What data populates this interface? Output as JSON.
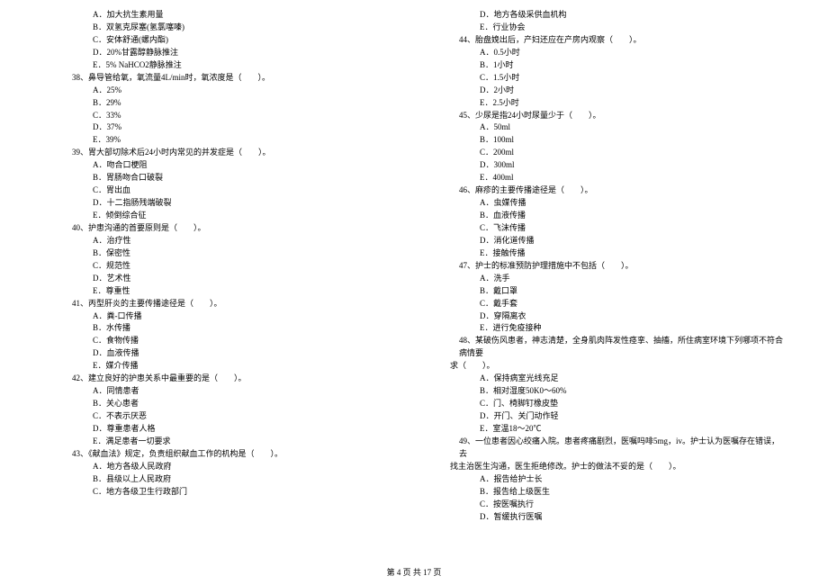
{
  "left_column": {
    "pre_options": [
      "A．加大抗生素用量",
      "B．双氢克尿塞(氢氯噻嗪)",
      "C．安体舒通(螺内酯)",
      "D．20%甘露醇静脉推注",
      "E．5% NaHCO2静脉推注"
    ],
    "questions": [
      {
        "number": "38、",
        "text": "鼻导管给氧，氧流量4L/min时，氧浓度是（　　）。",
        "options": [
          "A．25%",
          "B．29%",
          "C．33%",
          "D．37%",
          "E．39%"
        ]
      },
      {
        "number": "39、",
        "text": "胃大部切除术后24小时内常见的并发症是（　　）。",
        "options": [
          "A．吻合口梗阻",
          "B．胃肠吻合口破裂",
          "C．胃出血",
          "D．十二指肠残端破裂",
          "E．倾倒综合征"
        ]
      },
      {
        "number": "40、",
        "text": "护患沟通的首要原则是（　　）。",
        "options": [
          "A．治疗性",
          "B．保密性",
          "C．规范性",
          "D．艺术性",
          "E．尊重性"
        ]
      },
      {
        "number": "41、",
        "text": "丙型肝炎的主要传播途径是（　　）。",
        "options": [
          "A．粪-口传播",
          "B．水传播",
          "C．食物传播",
          "D．血液传播",
          "E．媒介传播"
        ]
      },
      {
        "number": "42、",
        "text": "建立良好的护患关系中最重要的是（　　）。",
        "options": [
          "A．同情患者",
          "B．关心患者",
          "C．不表示厌恶",
          "D．尊重患者人格",
          "E．满足患者一切要求"
        ]
      },
      {
        "number": "43、",
        "text": "《献血法》规定，负责组织献血工作的机构是（　　）。",
        "options": [
          "A．地方各级人民政府",
          "B．县级以上人民政府",
          "C．地方各级卫生行政部门"
        ]
      }
    ]
  },
  "right_column": {
    "pre_options": [
      "D．地方各级采供血机构",
      "E．行业协会"
    ],
    "questions": [
      {
        "number": "44、",
        "text": "胎盘娩出后，产妇还应在产房内观察（　　）。",
        "options": [
          "A．0.5小时",
          "B．1小时",
          "C．1.5小时",
          "D．2小时",
          "E．2.5小时"
        ]
      },
      {
        "number": "45、",
        "text": "少尿是指24小时尿量少于（　　）。",
        "options": [
          "A．50ml",
          "B．100ml",
          "C．200ml",
          "D．300ml",
          "E．400ml"
        ]
      },
      {
        "number": "46、",
        "text": "麻疹的主要传播途径是（　　）。",
        "options": [
          "A．虫媒传播",
          "B．血液传播",
          "C．飞沫传播",
          "D．消化道传播",
          "E．接触传播"
        ]
      },
      {
        "number": "47、",
        "text": "护士的标准预防护理措施中不包括（　　）。",
        "options": [
          "A．洗手",
          "B．戴口罩",
          "C．戴手套",
          "D．穿隔离衣",
          "E．进行免疫接种"
        ]
      },
      {
        "number": "48、",
        "text": "某破伤风患者，神志清楚，全身肌肉阵发性痉挛、抽搐，所住病室环境下列哪项不符合病情要求（　　）。",
        "wrapped": true,
        "options": [
          "A．保持病室光线充足",
          "B．相对湿度50K0～60%",
          "C．门、椅脚钉橡皮垫",
          "D．开门、关门动作轻",
          "E．室温18～20℃"
        ]
      },
      {
        "number": "49、",
        "text": "一位患者因心绞痛入院。患者疼痛剧烈，医嘱吗啡5mg，iv。护士认为医嘱存在错误，去找主治医生沟通，医生拒绝修改。护士的做法不妥的是（　　）。",
        "wrapped": true,
        "options": [
          "A．报告给护士长",
          "B．报告给上级医生",
          "C．按医嘱执行",
          "D．暂缓执行医嘱"
        ]
      }
    ]
  },
  "footer": {
    "text": "第 4 页 共 17 页"
  }
}
